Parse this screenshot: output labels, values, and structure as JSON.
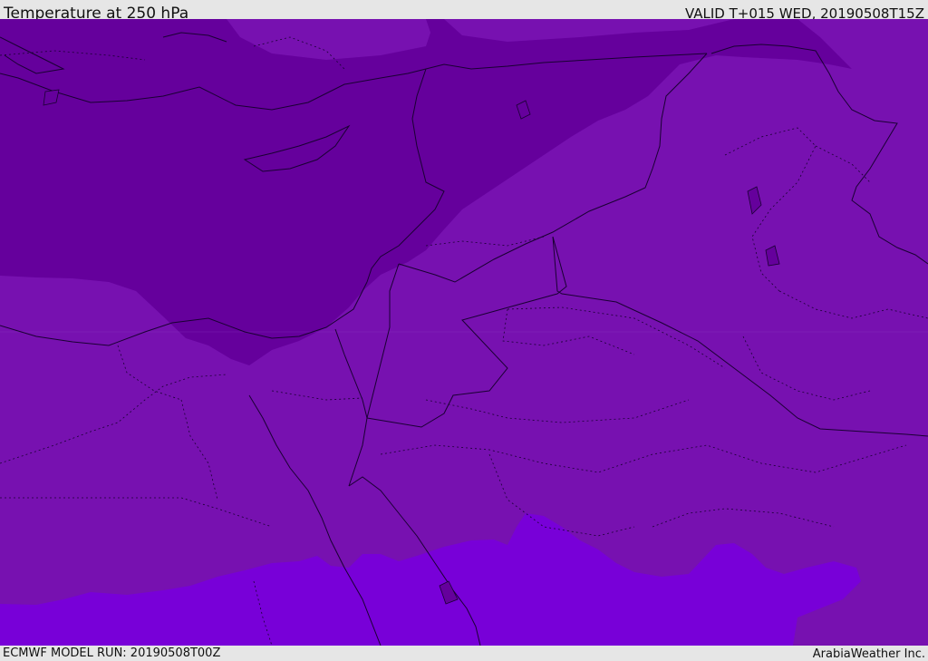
{
  "header": {
    "title": "Temperature at 250 hPa",
    "valid": "VALID T+015 WED, 20190508T15Z"
  },
  "footer": {
    "model_run": "ECMWF MODEL RUN: 20190508T00Z",
    "credit": "ArabiaWeather Inc."
  },
  "map": {
    "colors": {
      "cold_band": "#65009c",
      "mid_band": "#7711b0",
      "warm_band": "#7800d8",
      "land_border": "#1a0033"
    }
  }
}
